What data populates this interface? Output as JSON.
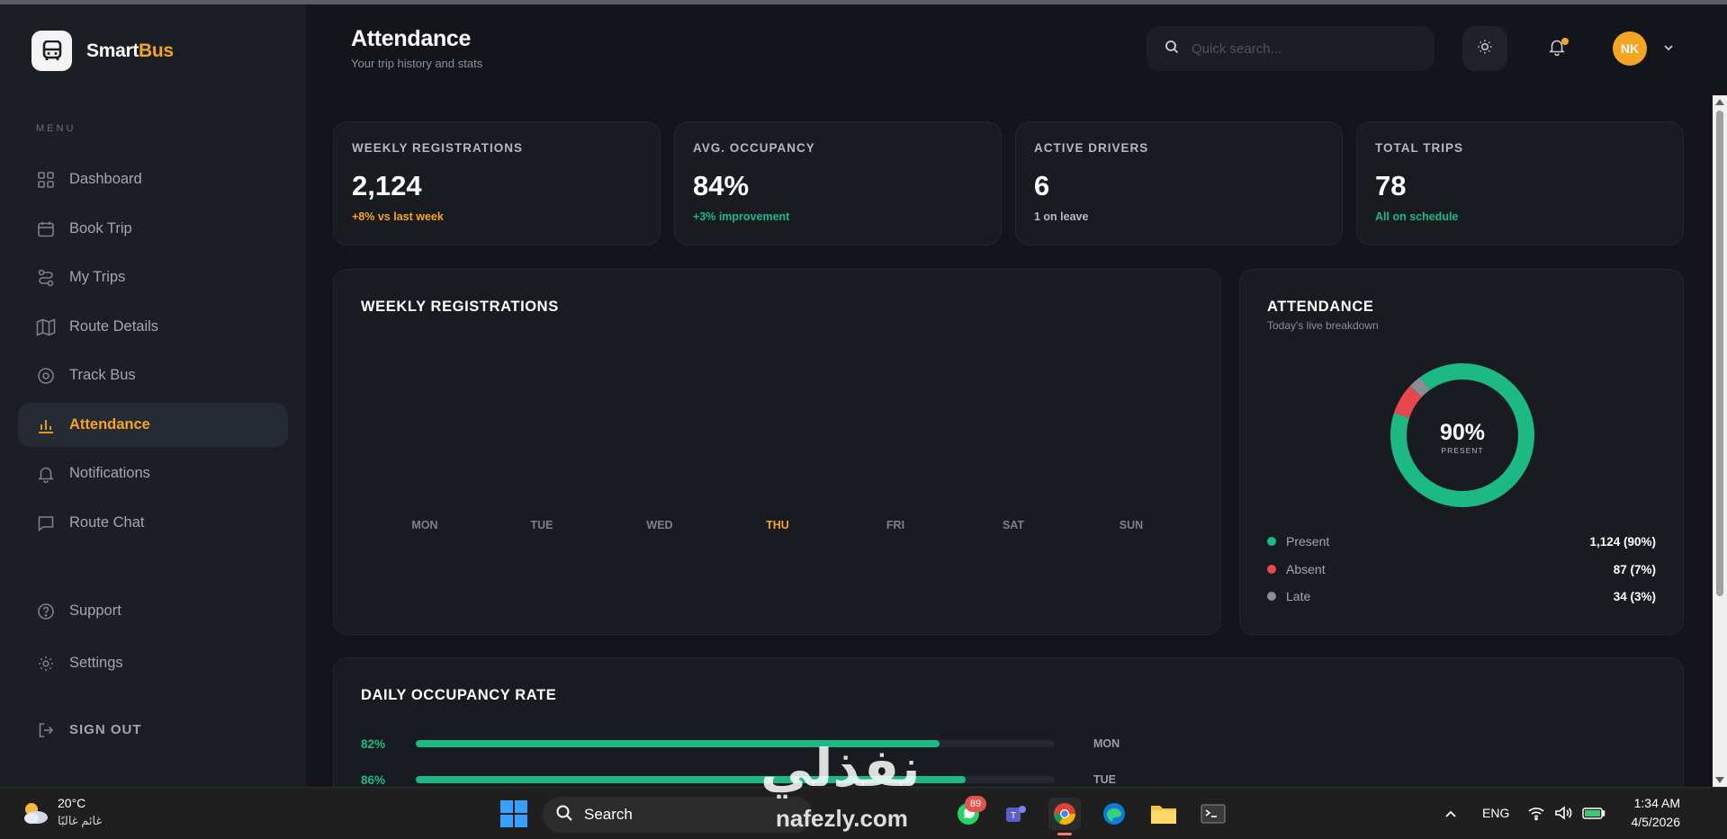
{
  "brand": {
    "name_part1": "Smart",
    "name_part2": "Bus"
  },
  "sidebar": {
    "menu_label": "MENU",
    "items": [
      {
        "label": "Dashboard",
        "icon": "grid-icon"
      },
      {
        "label": "Book Trip",
        "icon": "calendar-icon"
      },
      {
        "label": "My Trips",
        "icon": "route-icon"
      },
      {
        "label": "Route Details",
        "icon": "map-icon"
      },
      {
        "label": "Track Bus",
        "icon": "target-icon"
      },
      {
        "label": "Attendance",
        "icon": "bar-chart-icon",
        "active": true
      },
      {
        "label": "Notifications",
        "icon": "bell-icon"
      },
      {
        "label": "Route Chat",
        "icon": "chat-icon"
      }
    ],
    "support": "Support",
    "settings": "Settings",
    "signout": "SIGN OUT"
  },
  "header": {
    "title": "Attendance",
    "subtitle": "Your trip history and stats",
    "search_placeholder": "Quick search...",
    "avatar_initials": "NK"
  },
  "stats": [
    {
      "label": "WEEKLY REGISTRATIONS",
      "value": "2,124",
      "sub": "+8% vs last week",
      "sub_color": "#f5a524"
    },
    {
      "label": "AVG. OCCUPANCY",
      "value": "84%",
      "sub": "+3% improvement",
      "sub_color": "#1db985"
    },
    {
      "label": "ACTIVE DRIVERS",
      "value": "6",
      "sub": "1 on leave",
      "sub_color": "#b6b9bf"
    },
    {
      "label": "TOTAL TRIPS",
      "value": "78",
      "sub": "All on schedule",
      "sub_color": "#1db985"
    }
  ],
  "weekly_chart": {
    "title": "WEEKLY REGISTRATIONS",
    "days": [
      "MON",
      "TUE",
      "WED",
      "THU",
      "FRI",
      "SAT",
      "SUN"
    ],
    "highlight_day": "THU"
  },
  "attendance": {
    "title": "ATTENDANCE",
    "subtitle": "Today's live breakdown",
    "center_value": "90%",
    "center_label": "PRESENT",
    "breakdown": [
      {
        "name": "Present",
        "value": "1,124 (90%)",
        "pct": 90,
        "color": "#1db985"
      },
      {
        "name": "Absent",
        "value": "87 (7%)",
        "pct": 7,
        "color": "#e5484d"
      },
      {
        "name": "Late",
        "value": "34 (3%)",
        "pct": 3,
        "color": "#8a8d93"
      }
    ]
  },
  "occupancy": {
    "title": "DAILY OCCUPANCY RATE",
    "rows": [
      {
        "pct_label": "82%",
        "pct": 82,
        "day": "MON"
      },
      {
        "pct_label": "86%",
        "pct": 86,
        "day": "TUE"
      }
    ]
  },
  "taskbar": {
    "weather_temp": "20°C",
    "weather_desc": "غائم غالبًا",
    "search_label": "Search",
    "whatsapp_badge": "89",
    "lang": "ENG",
    "time": "1:34 AM",
    "date": "4/5/2026"
  },
  "watermark": {
    "text": "نفذلي",
    "sub": "nafezly.com"
  }
}
